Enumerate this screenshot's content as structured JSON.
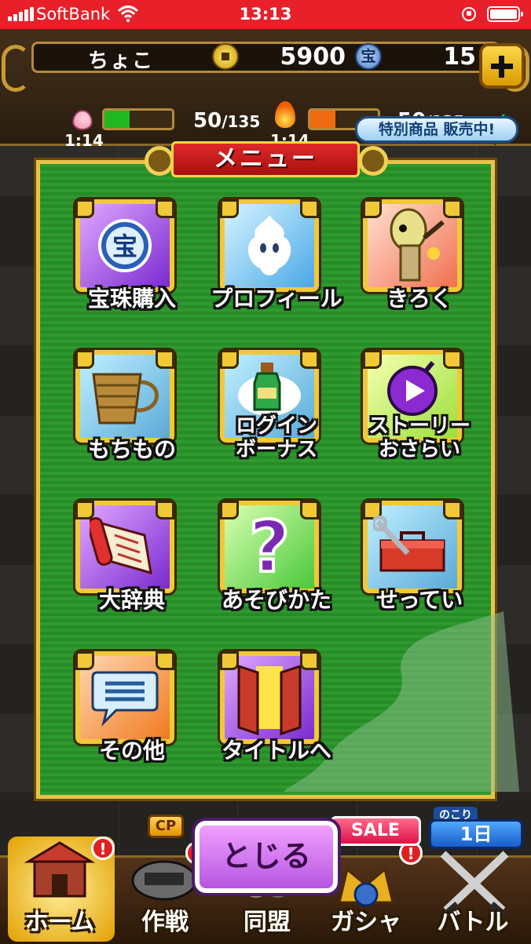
{
  "status_bar": {
    "carrier": "SoftBank",
    "time": "13:13"
  },
  "header": {
    "player_name": "ちょこ",
    "coins": "5900",
    "gem_symbol": "宝",
    "gems": "15",
    "stamina": {
      "value": "50",
      "max": "/135",
      "timer": "1:14",
      "fill_percent": 37,
      "color": "#22b822"
    },
    "battle_points": {
      "value": "50",
      "max": "/135",
      "timer": "1:14",
      "fill_percent": 37,
      "color": "#f06a10"
    },
    "special_banner": "特別商品 販売中!"
  },
  "menu": {
    "title": "メニュー",
    "items": [
      {
        "label": "宝珠購入",
        "icon": "treasure-orb-icon"
      },
      {
        "label": "プロフィール",
        "icon": "profile-spirit-icon"
      },
      {
        "label": "きろく",
        "icon": "record-character-icon"
      },
      {
        "label": "もちもの",
        "icon": "basket-icon"
      },
      {
        "label": "ログイン ボーナス",
        "line1": "ログイン",
        "line2": "ボーナス",
        "icon": "potion-bottle-icon"
      },
      {
        "label": "ストーリー おさらい",
        "line1": "ストーリー",
        "line2": "おさらい",
        "icon": "play-bomb-icon"
      },
      {
        "label": "大辞典",
        "icon": "scroll-icon"
      },
      {
        "label": "あそびかた",
        "icon": "question-mark-icon"
      },
      {
        "label": "せってい",
        "icon": "toolbox-icon"
      },
      {
        "label": "その他",
        "icon": "speech-bubble-icon"
      },
      {
        "label": "タイトルへ",
        "icon": "door-icon"
      }
    ]
  },
  "bottom_nav": {
    "close_button": "とじる",
    "cp_badge": "CP",
    "sale_badge": "SALE",
    "remain_caption": "のこり",
    "remain_value": "1日",
    "alert_mark": "!",
    "tabs": [
      {
        "label": "ホーム",
        "icon": "castle-icon"
      },
      {
        "label": "作戦",
        "icon": "strategy-icon"
      },
      {
        "label": "同盟",
        "icon": "alliance-icon"
      },
      {
        "label": "ガシャ",
        "icon": "gacha-icon"
      },
      {
        "label": "バトル",
        "icon": "crossed-swords-icon"
      }
    ]
  }
}
